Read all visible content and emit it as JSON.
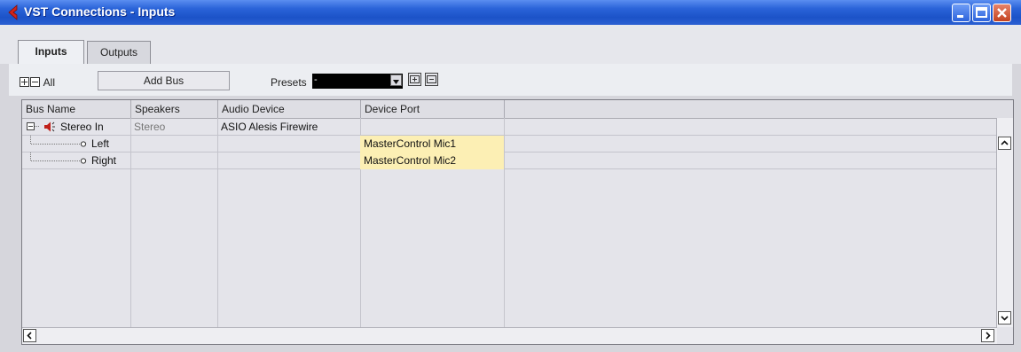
{
  "window": {
    "title": "VST Connections - Inputs",
    "accent": "#2a63d8",
    "logo_color": "#d2241c"
  },
  "tabs": [
    {
      "label": "Inputs",
      "active": true
    },
    {
      "label": "Outputs",
      "active": false
    }
  ],
  "toolbar": {
    "expand_all_label": "All",
    "add_bus_label": "Add Bus",
    "presets_label": "Presets",
    "presets_value": "-"
  },
  "table": {
    "columns": [
      "Bus Name",
      "Speakers",
      "Audio Device",
      "Device Port"
    ],
    "rows": [
      {
        "bus_name": "Stereo In",
        "speakers": "Stereo",
        "audio_device": "ASIO Alesis Firewire",
        "device_port": "",
        "level": 0
      },
      {
        "bus_name": "Left",
        "speakers": "",
        "audio_device": "",
        "device_port": "MasterControl Mic1",
        "level": 1
      },
      {
        "bus_name": "Right",
        "speakers": "",
        "audio_device": "",
        "device_port": "MasterControl Mic2",
        "level": 1
      }
    ],
    "port_highlight": "#fcefb4"
  }
}
